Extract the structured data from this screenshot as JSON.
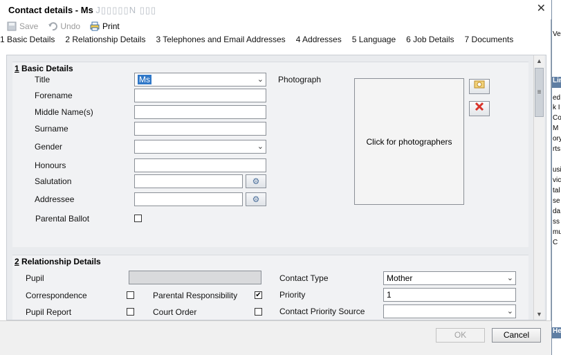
{
  "window": {
    "title": "Contact details - Ms",
    "title_obscured": "J▯▯▯▯▯N ▯▯▯"
  },
  "toolbar": {
    "save_label": "Save",
    "undo_label": "Undo",
    "print_label": "Print"
  },
  "tabs": [
    {
      "label": "1 Basic Details"
    },
    {
      "label": "2 Relationship Details"
    },
    {
      "label": "3 Telephones and Email Addresses"
    },
    {
      "label": "4 Addresses"
    },
    {
      "label": "5 Language"
    },
    {
      "label": "6 Job Details"
    },
    {
      "label": "7 Documents"
    }
  ],
  "basic": {
    "heading_num": "1",
    "heading_text": " Basic Details",
    "title_label": "Title",
    "title_value": "Ms",
    "forename_label": "Forename",
    "middle_label": "Middle Name(s)",
    "surname_label": "Surname",
    "gender_label": "Gender",
    "honours_label": "Honours",
    "salutation_label": "Salutation",
    "addressee_label": "Addressee",
    "ballot_label": "Parental Ballot",
    "photo_label": "Photograph",
    "photo_box_text": "Click for photographers"
  },
  "relationship": {
    "heading_num": "2",
    "heading_text": " Relationship Details",
    "pupil_label": "Pupil",
    "correspondence_label": "Correspondence",
    "parental_resp_label": "Parental Responsibility",
    "parental_resp_checked": "✔",
    "pupil_report_label": "Pupil Report",
    "court_order_label": "Court Order",
    "contact_type_label": "Contact Type",
    "contact_type_value": "Mother",
    "priority_label": "Priority",
    "priority_value": "1",
    "priority_source_label": "Contact Priority Source",
    "priority_source_value": ""
  },
  "footer": {
    "ok_label": "OK",
    "cancel_label": "Cancel"
  },
  "side_panel": {
    "lines": [
      "Veh",
      "Lin",
      "ed",
      "k I",
      "Co",
      "M",
      "ory",
      "rts",
      "usi",
      "vic",
      "tal",
      "se",
      "da",
      "ss",
      "mu",
      "C",
      "He"
    ]
  }
}
